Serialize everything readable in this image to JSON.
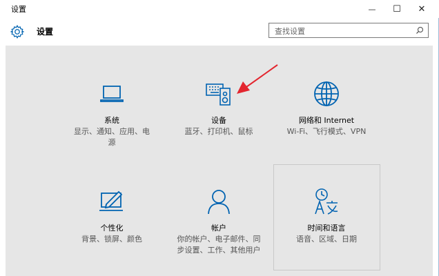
{
  "window": {
    "title": "设置",
    "minimize_glyph": "—",
    "maximize_glyph": "☐",
    "close_glyph": "✕"
  },
  "header": {
    "title": "设置",
    "search_placeholder": "查找设置"
  },
  "colors": {
    "accent": "#0063b1",
    "arrow": "#e3262f",
    "content_bg": "#e6e6e6"
  },
  "tiles": [
    {
      "name": "系统",
      "desc": "显示、通知、应用、电源",
      "icon": "laptop-icon"
    },
    {
      "name": "设备",
      "desc": "蓝牙、打印机、鼠标",
      "icon": "devices-icon"
    },
    {
      "name": "网络和 Internet",
      "desc": "Wi-Fi、飞行模式、VPN",
      "icon": "globe-icon"
    },
    {
      "name": "个性化",
      "desc": "背景、锁屏、颜色",
      "icon": "personalization-icon"
    },
    {
      "name": "帐户",
      "desc": "你的帐户、电子邮件、同步设置、工作、其他用户",
      "icon": "person-icon"
    },
    {
      "name": "时间和语言",
      "desc": "语音、区域、日期",
      "icon": "time-language-icon"
    }
  ]
}
